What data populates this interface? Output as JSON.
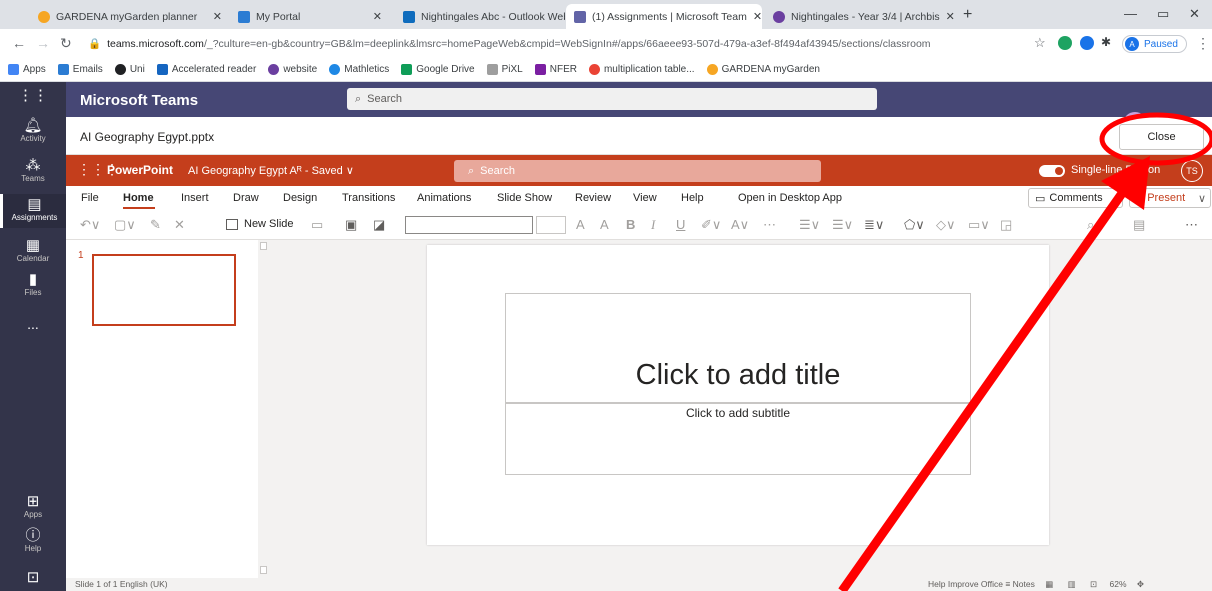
{
  "browser": {
    "tabs": [
      {
        "title": "GARDENA myGarden planner",
        "icon": "gardena-icon",
        "color": "#f6a623"
      },
      {
        "title": "My Portal",
        "icon": "office-icon",
        "color": "#2b7cd3"
      },
      {
        "title": "Nightingales Abc - Outlook Web",
        "icon": "outlook-icon",
        "color": "#0f6cbd"
      },
      {
        "title": "(1) Assignments | Microsoft Team",
        "icon": "teams-icon",
        "color": "#6264a7"
      },
      {
        "title": "Nightingales - Year 3/4 | Archbis",
        "icon": "school-icon",
        "color": "#6b3fa0"
      }
    ],
    "url_host": "teams.microsoft.com",
    "url_rest": "/_?culture=en-gb&country=GB&lm=deeplink&lmsrc=homePageWeb&cmpid=WebSignIn#/apps/66aeee93-507d-479a-a3ef-8f494af43945/sections/classroom",
    "profile_initial": "A",
    "profile_label": "Paused",
    "bookmarks": [
      {
        "label": "Apps",
        "color": "#4285f4"
      },
      {
        "label": "Emails",
        "color": "#2b7cd3"
      },
      {
        "label": "Uni",
        "color": "#202124"
      },
      {
        "label": "Accelerated reader",
        "color": "#1565c0"
      },
      {
        "label": "website",
        "color": "#6b3fa0"
      },
      {
        "label": "Mathletics",
        "color": "#1e88e5"
      },
      {
        "label": "Google Drive",
        "color": "#0f9d58"
      },
      {
        "label": "PiXL",
        "color": "#9e9e9e"
      },
      {
        "label": "NFER",
        "color": "#7b1fa2"
      },
      {
        "label": "multiplication table...",
        "color": "#ea4335"
      },
      {
        "label": "GARDENA myGarden",
        "color": "#f6a623"
      }
    ]
  },
  "teams": {
    "brand": "Microsoft Teams",
    "search_placeholder": "Search",
    "rail": [
      {
        "label": "Activity",
        "icon": "bell-icon"
      },
      {
        "label": "Teams",
        "icon": "teams-icon"
      },
      {
        "label": "Assignments",
        "icon": "assignments-icon"
      },
      {
        "label": "Calendar",
        "icon": "calendar-icon"
      },
      {
        "label": "Files",
        "icon": "file-icon"
      },
      {
        "label": "...",
        "icon": "more-icon"
      },
      {
        "label": "Apps",
        "icon": "apps-icon"
      },
      {
        "label": "Help",
        "icon": "help-icon"
      }
    ],
    "file_name": "AI Geography Egypt.pptx",
    "close_label": "Close"
  },
  "powerpoint": {
    "app_name": "PowerPoint",
    "doc_title": "AI Geography Egypt Aᴿ - Saved ∨",
    "search_placeholder": "Search",
    "ribbon_toggle_label": "Single-line Ribbon",
    "user_initials": "TS",
    "menu": [
      "File",
      "Home",
      "Insert",
      "Draw",
      "Design",
      "Transitions",
      "Animations",
      "Slide Show",
      "Review",
      "View",
      "Help",
      "Open in Desktop App"
    ],
    "comments_label": "Comments",
    "present_label": "Present",
    "new_slide_label": "New Slide",
    "slide_number": "1",
    "title_placeholder": "Click to add title",
    "subtitle_placeholder": "Click to add subtitle",
    "status_left": "Slide 1 of 1   English (UK)",
    "status_right": "Help Improve Office   ≡ Notes",
    "zoom": "62%"
  },
  "colors": {
    "teams_purple": "#464775",
    "rail": "#33344a",
    "ppt_orange": "#c43e1c",
    "annotation_red": "#ff0000"
  }
}
